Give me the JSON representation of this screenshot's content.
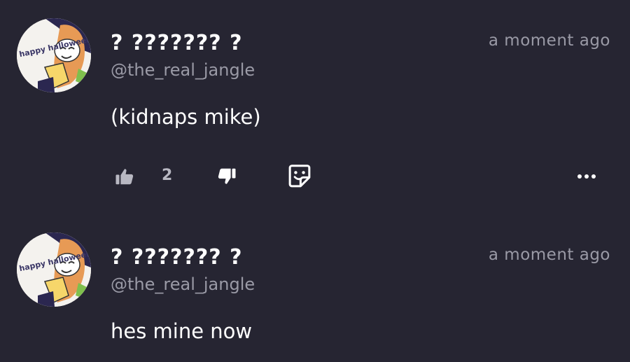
{
  "comments": [
    {
      "display_name": "? ??????? ?",
      "handle": "@the_real_jangle",
      "timestamp": "a moment ago",
      "body": "(kidnaps mike)",
      "like_count": "2",
      "avatar_text": "happy halloween"
    },
    {
      "display_name": "? ??????? ?",
      "handle": "@the_real_jangle",
      "timestamp": "a moment ago",
      "body": "hes mine now",
      "avatar_text": "happy halloween"
    }
  ],
  "icons": {
    "like": "thumbs-up-icon",
    "dislike": "thumbs-down-icon",
    "sticker": "sticker-reaction-icon",
    "more": "more-options-icon"
  },
  "colors": {
    "background": "#262532",
    "text_primary": "#ffffff",
    "text_muted": "#9a9aa6"
  }
}
